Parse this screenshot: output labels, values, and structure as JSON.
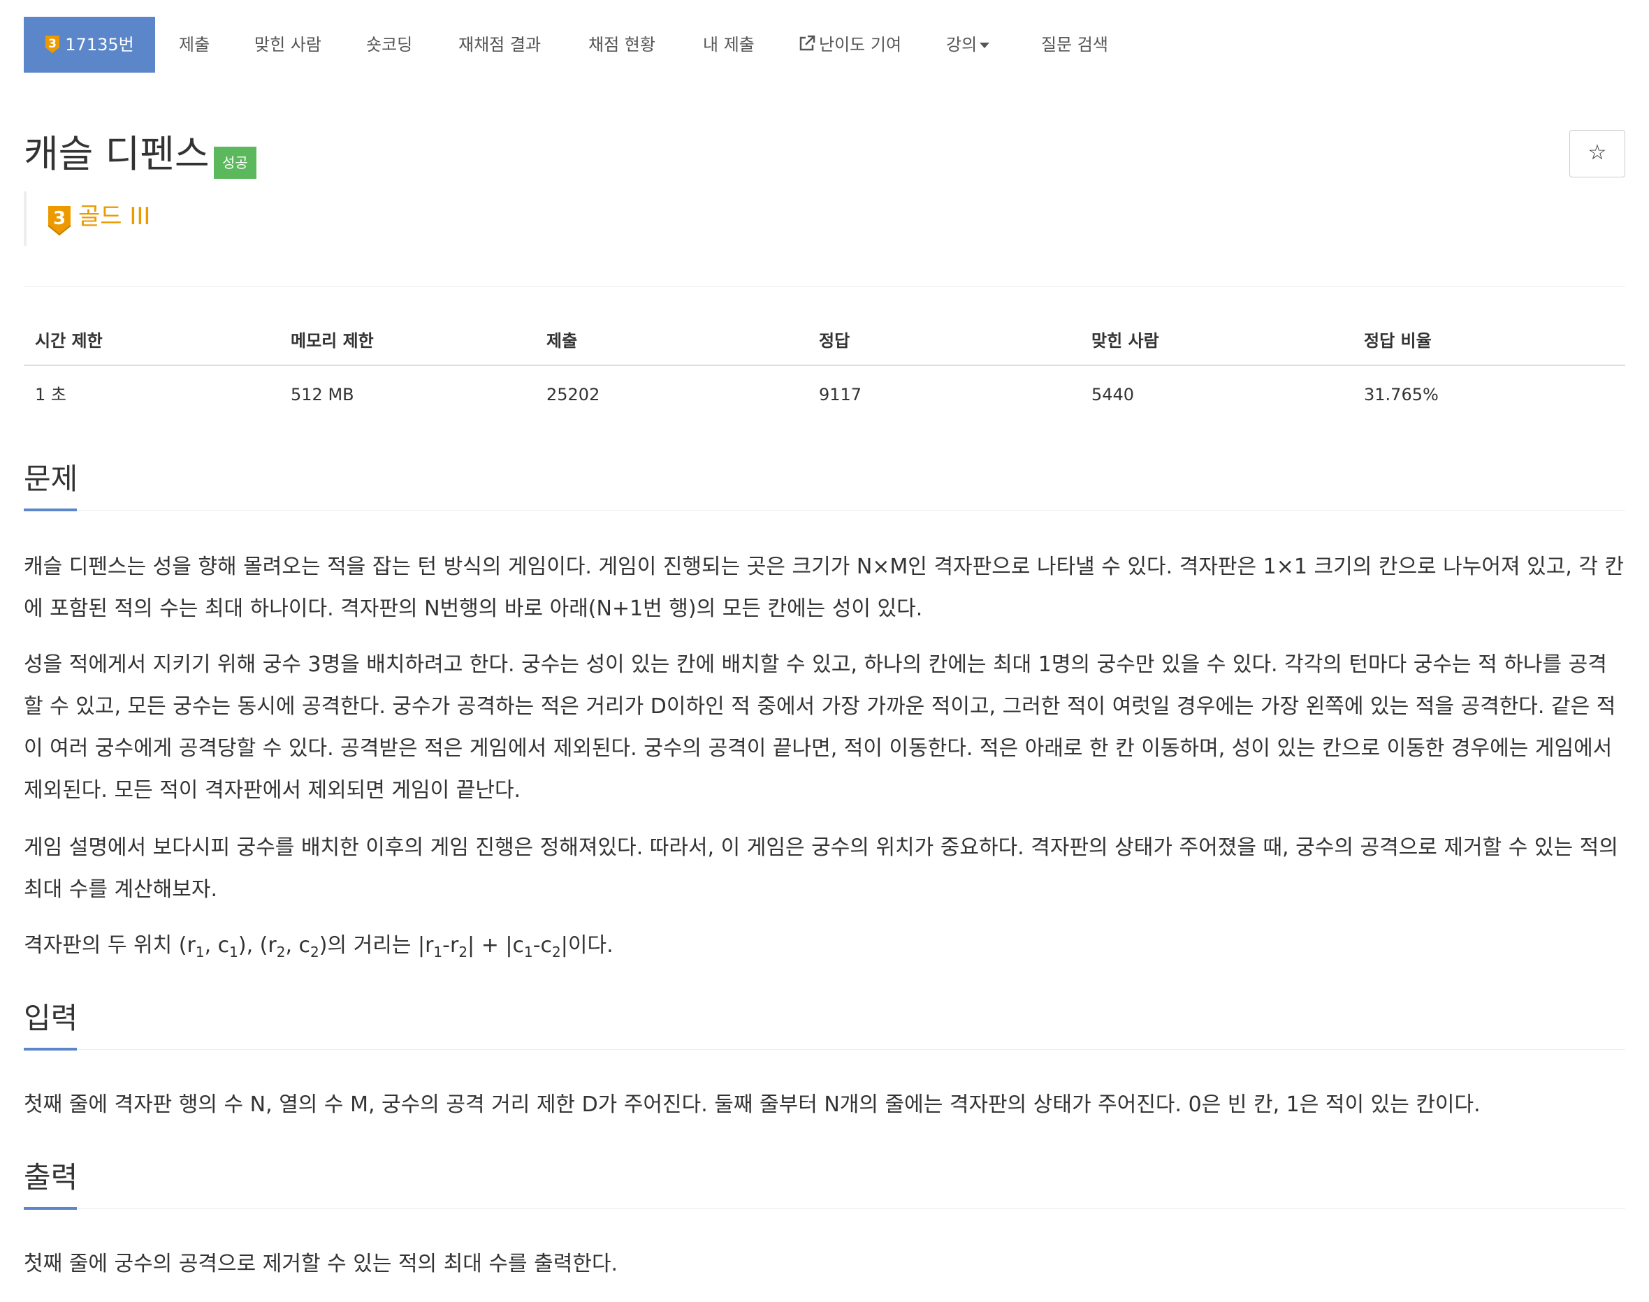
{
  "nav": {
    "problem": {
      "tier_badge": "3",
      "number": "17135번"
    },
    "items": [
      {
        "label": "제출"
      },
      {
        "label": "맞힌 사람"
      },
      {
        "label": "숏코딩"
      },
      {
        "label": "재채점 결과"
      },
      {
        "label": "채점 현황"
      },
      {
        "label": "내 제출"
      },
      {
        "label": "난이도 기여",
        "icon": "external-link-icon"
      },
      {
        "label": "강의",
        "icon": "caret-down-icon"
      },
      {
        "label": "질문 검색"
      }
    ]
  },
  "problem": {
    "title": "캐슬 디펜스",
    "status_badge": "성공",
    "star_symbol": "☆",
    "tier_number": "3",
    "tier_label": "골드 III",
    "tier_color": "#ec9a00"
  },
  "stats": {
    "headers": [
      "시간 제한",
      "메모리 제한",
      "제출",
      "정답",
      "맞힌 사람",
      "정답 비율"
    ],
    "values": [
      "1 초",
      "512 MB",
      "25202",
      "9117",
      "5440",
      "31.765%"
    ]
  },
  "sections": {
    "problem_title": "문제",
    "p1": "캐슬 디펜스는 성을 향해 몰려오는 적을 잡는 턴 방식의 게임이다. 게임이 진행되는 곳은 크기가 N×M인 격자판으로 나타낼 수 있다. 격자판은 1×1 크기의 칸으로 나누어져 있고, 각 칸에 포함된 적의 수는 최대 하나이다. 격자판의 N번행의 바로 아래(N+1번 행)의 모든 칸에는 성이 있다.",
    "p2": "성을 적에게서 지키기 위해 궁수 3명을 배치하려고 한다. 궁수는 성이 있는 칸에 배치할 수 있고, 하나의 칸에는 최대 1명의 궁수만 있을 수 있다. 각각의 턴마다 궁수는 적 하나를 공격할 수 있고, 모든 궁수는 동시에 공격한다. 궁수가 공격하는 적은 거리가 D이하인 적 중에서 가장 가까운 적이고, 그러한 적이 여럿일 경우에는 가장 왼쪽에 있는 적을 공격한다. 같은 적이 여러 궁수에게 공격당할 수 있다. 공격받은 적은 게임에서 제외된다. 궁수의 공격이 끝나면, 적이 이동한다. 적은 아래로 한 칸 이동하며, 성이 있는 칸으로 이동한 경우에는 게임에서 제외된다. 모든 적이 격자판에서 제외되면 게임이 끝난다.",
    "p3": "게임 설명에서 보다시피 궁수를 배치한 이후의 게임 진행은 정해져있다. 따라서, 이 게임은 궁수의 위치가 중요하다. 격자판의 상태가 주어졌을 때, 궁수의 공격으로 제거할 수 있는 적의 최대 수를 계산해보자.",
    "p4": {
      "t1": "격자판의 두 위치 (r",
      "s1": "1",
      "t2": ", c",
      "s2": "1",
      "t3": "), (r",
      "s3": "2",
      "t4": ", c",
      "s4": "2",
      "t5": ")의 거리는 |r",
      "s5": "1",
      "t6": "-r",
      "s6": "2",
      "t7": "| + |c",
      "s7": "1",
      "t8": "-c",
      "s8": "2",
      "t9": "|이다."
    },
    "input_title": "입력",
    "input": "첫째 줄에 격자판 행의 수 N, 열의 수 M, 궁수의 공격 거리 제한 D가 주어진다. 둘째 줄부터 N개의 줄에는 격자판의 상태가 주어진다. 0은 빈 칸, 1은 적이 있는 칸이다.",
    "output_title": "출력",
    "output": "첫째 줄에 궁수의 공격으로 제거할 수 있는 적의 최대 수를 출력한다."
  },
  "colors": {
    "accent": "#5b86c9",
    "success": "#5cb85c",
    "gold": "#ec9a00"
  }
}
